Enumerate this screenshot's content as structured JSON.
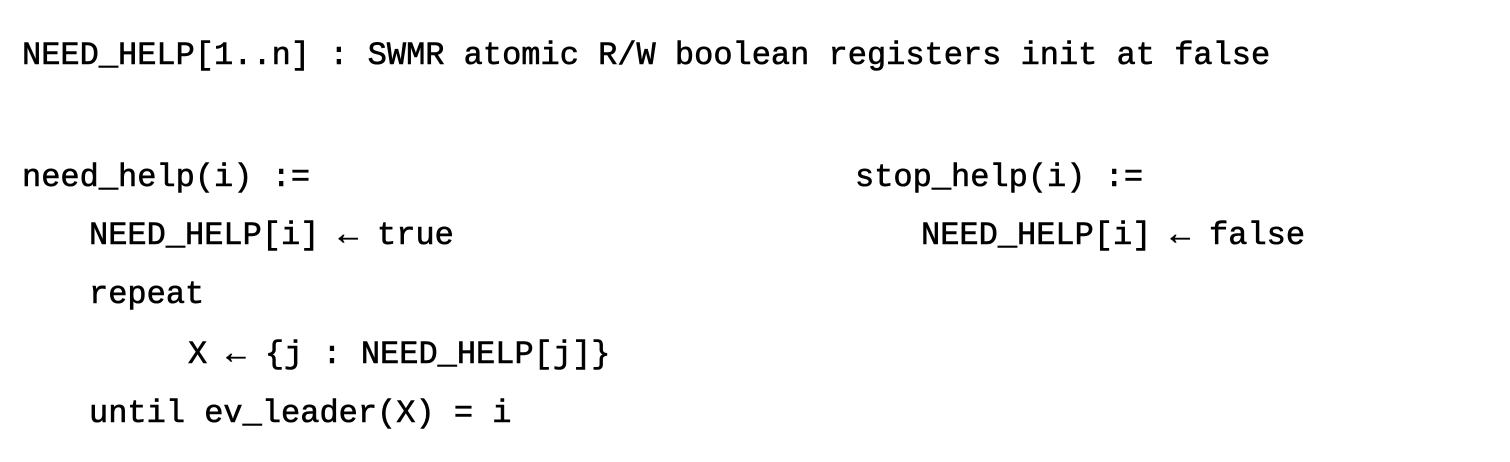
{
  "declaration": "NEED_HELP[1..n] : SWMR atomic R/W boolean registers init at false",
  "need_help": {
    "header": "need_help(i) :=",
    "lines": [
      "NEED_HELP[i] ← true",
      "repeat",
      "X ← {j : NEED_HELP[j]}",
      "until ev_leader(X) = i"
    ]
  },
  "stop_help": {
    "header": "stop_help(i) :=",
    "lines": [
      "NEED_HELP[i] ← false"
    ]
  }
}
